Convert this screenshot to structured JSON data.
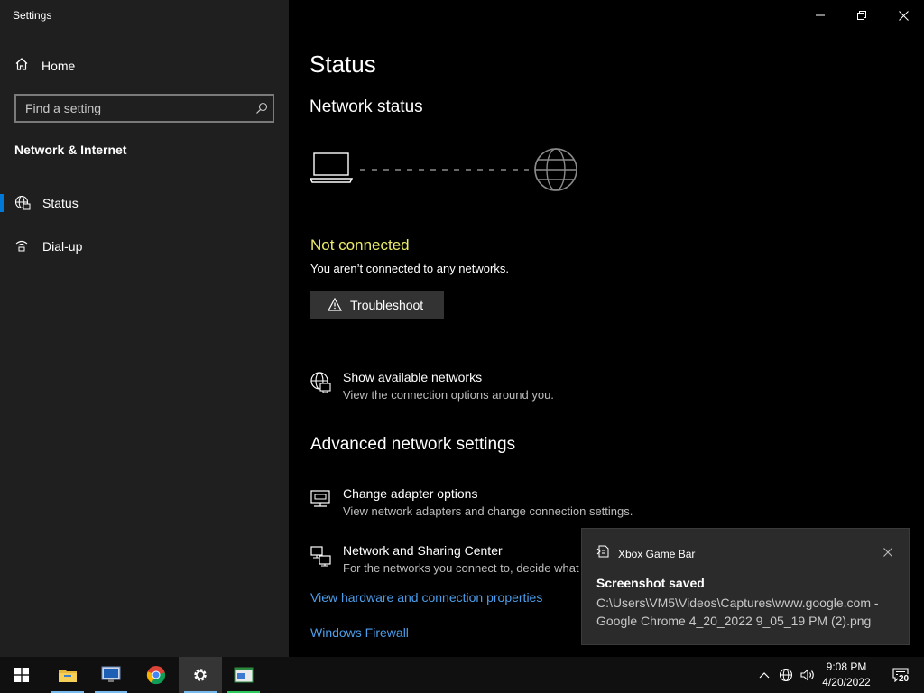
{
  "window": {
    "title": "Settings"
  },
  "sidebar": {
    "home_label": "Home",
    "search_placeholder": "Find a setting",
    "section_title": "Network & Internet",
    "items": [
      {
        "label": "Status",
        "icon": "globe-network-icon",
        "active": true
      },
      {
        "label": "Dial-up",
        "icon": "dialup-icon",
        "active": false
      }
    ]
  },
  "main": {
    "title": "Status",
    "network_status_title": "Network status",
    "connection_state": "Not connected",
    "connection_description": "You aren’t connected to any networks.",
    "troubleshoot_label": "Troubleshoot",
    "show_networks": {
      "title": "Show available networks",
      "description": "View the connection options around you."
    },
    "advanced_title": "Advanced network settings",
    "adapter_options": {
      "title": "Change adapter options",
      "description": "View network adapters and change connection settings."
    },
    "sharing_center": {
      "title": "Network and Sharing Center",
      "description": "For the networks you connect to, decide what"
    },
    "hardware_link": "View hardware and connection properties",
    "firewall_link": "Windows Firewall"
  },
  "toast": {
    "app_name": "Xbox Game Bar",
    "heading": "Screenshot saved",
    "body": "C:\\Users\\VM5\\Videos\\Captures\\www.google.com - Google Chrome 4_20_2022 9_05_19 PM (2).png"
  },
  "taskbar": {
    "time": "9:08 PM",
    "date": "4/20/2022",
    "notification_count": "20"
  },
  "colors": {
    "accent": "#0078d7",
    "warning_text": "#ecec6a",
    "link": "#4c9eeb",
    "sidebar_bg": "#1f1f1f"
  }
}
